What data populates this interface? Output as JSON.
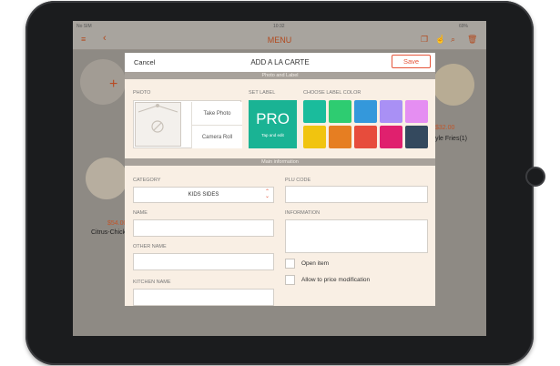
{
  "status_bar": {
    "carrier": "No SIM",
    "time": "10:32",
    "battery": "69%"
  },
  "nav": {
    "title": "MENU"
  },
  "background": {
    "left_price": "$54.00",
    "left_name": "Citrus-Chick",
    "right_price": "$32.00",
    "right_name": "yle Fries(1)"
  },
  "modal": {
    "cancel_label": "Cancel",
    "title": "ADD A LA CARTE",
    "save_label": "Save",
    "section_photo": "Photo and Label",
    "photo_label": "PHOTO",
    "take_photo": "Take Photo",
    "camera_roll": "Camera Roll",
    "set_label_label": "SET LABEL",
    "pro_text": "PRO",
    "pro_hint": "Tap and edit",
    "color_label": "CHOOSE LABEL COLOR",
    "colors": [
      "#1abc9c",
      "#2ecc71",
      "#3498db",
      "#a990f5",
      "#e58ef2",
      "#f1c40f",
      "#e67e22",
      "#e74c3c",
      "#e0206e",
      "#34495e"
    ],
    "section_main": "Main information",
    "category_label": "CATEGORY",
    "category_value": "KIDS SIDES",
    "plu_label": "PLU CODE",
    "name_label": "NAME",
    "information_label": "INFORMATION",
    "other_name_label": "OTHER NAME",
    "open_item": "Open item",
    "allow_price": "Allow to price modification",
    "kitchen_name_label": "KITCHEN NAME"
  }
}
